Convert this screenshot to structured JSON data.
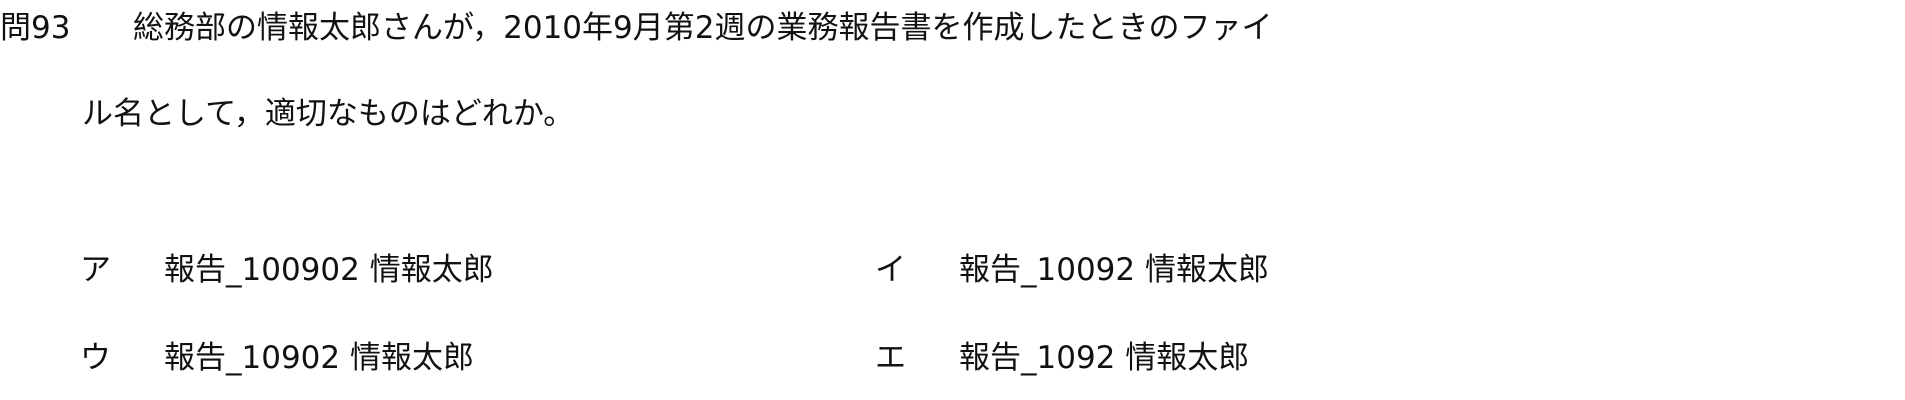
{
  "question": {
    "number": "問93",
    "line1": "総務部の情報太郎さんが，2010年9月第2週の業務報告書を作成したときのファイ",
    "line2": "ル名として，適切なものはどれか。"
  },
  "choices": [
    {
      "label": "ア",
      "text": "報告_100902 情報太郎"
    },
    {
      "label": "イ",
      "text": "報告_10092 情報太郎"
    },
    {
      "label": "ウ",
      "text": "報告_10902 情報太郎"
    },
    {
      "label": "エ",
      "text": "報告_1092 情報太郎"
    }
  ]
}
